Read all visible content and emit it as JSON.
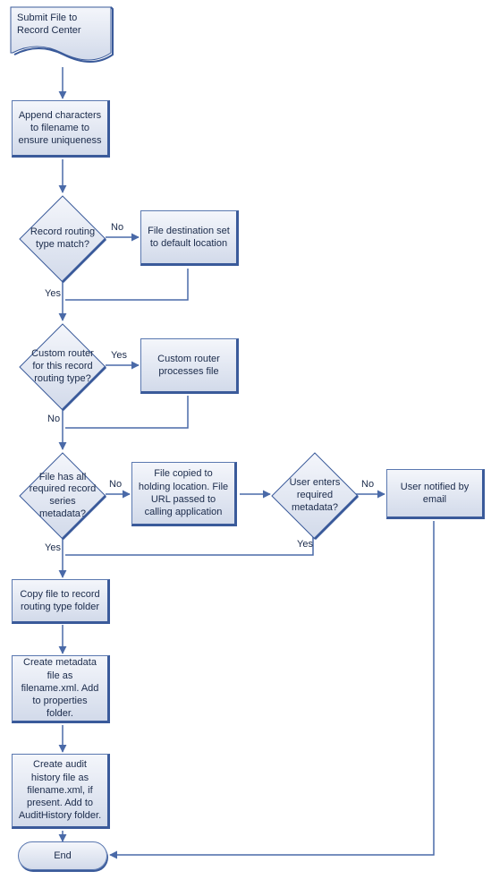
{
  "chart_data": {
    "type": "flowchart",
    "title": "",
    "nodes": [
      {
        "id": "start",
        "type": "document",
        "label": "Submit File to Record Center"
      },
      {
        "id": "append",
        "type": "process",
        "label": "Append characters to filename to ensure uniqueness"
      },
      {
        "id": "route_match",
        "type": "decision",
        "label": "Record routing type match?"
      },
      {
        "id": "default_loc",
        "type": "process",
        "label": "File destination set to default location"
      },
      {
        "id": "custom_router",
        "type": "decision",
        "label": "Custom router for this record routing type?"
      },
      {
        "id": "router_processes",
        "type": "process",
        "label": "Custom router processes file"
      },
      {
        "id": "has_metadata",
        "type": "decision",
        "label": "File has all required record series metadata?"
      },
      {
        "id": "copied_holding",
        "type": "process",
        "label": "File copied to holding location. File URL passed to calling application"
      },
      {
        "id": "user_enters",
        "type": "decision",
        "label": "User enters required metadata?"
      },
      {
        "id": "user_notified",
        "type": "process",
        "label": "User notified by email"
      },
      {
        "id": "copy_folder",
        "type": "process",
        "label": "Copy file to record routing type folder"
      },
      {
        "id": "create_metadata",
        "type": "process",
        "label": "Create metadata file as filename.xml. Add to properties folder."
      },
      {
        "id": "create_audit",
        "type": "process",
        "label": "Create audit history file as filename.xml, if present. Add to AuditHistory folder."
      },
      {
        "id": "end",
        "type": "terminator",
        "label": "End"
      }
    ],
    "edges": [
      {
        "from": "start",
        "to": "append",
        "label": ""
      },
      {
        "from": "append",
        "to": "route_match",
        "label": ""
      },
      {
        "from": "route_match",
        "to": "default_loc",
        "label": "No"
      },
      {
        "from": "route_match",
        "to": "custom_router",
        "label": "Yes"
      },
      {
        "from": "default_loc",
        "to": "custom_router",
        "label": ""
      },
      {
        "from": "custom_router",
        "to": "router_processes",
        "label": "Yes"
      },
      {
        "from": "custom_router",
        "to": "has_metadata",
        "label": "No"
      },
      {
        "from": "router_processes",
        "to": "has_metadata",
        "label": ""
      },
      {
        "from": "has_metadata",
        "to": "copied_holding",
        "label": "No"
      },
      {
        "from": "has_metadata",
        "to": "copy_folder",
        "label": "Yes"
      },
      {
        "from": "copied_holding",
        "to": "user_enters",
        "label": ""
      },
      {
        "from": "user_enters",
        "to": "copy_folder",
        "label": "Yes"
      },
      {
        "from": "user_enters",
        "to": "user_notified",
        "label": "No"
      },
      {
        "from": "user_notified",
        "to": "end",
        "label": ""
      },
      {
        "from": "copy_folder",
        "to": "create_metadata",
        "label": ""
      },
      {
        "from": "create_metadata",
        "to": "create_audit",
        "label": ""
      },
      {
        "from": "create_audit",
        "to": "end",
        "label": ""
      }
    ]
  },
  "labels": {
    "yes": "Yes",
    "no": "No"
  }
}
